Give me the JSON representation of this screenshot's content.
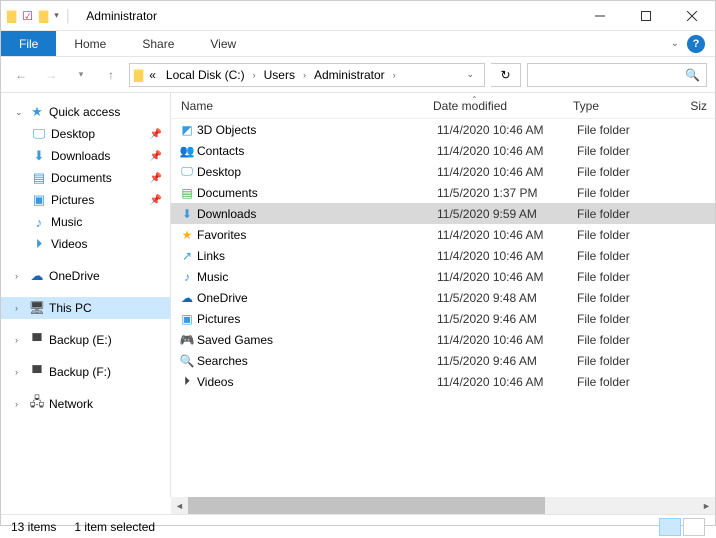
{
  "window": {
    "title": "Administrator"
  },
  "ribbon": {
    "file": "File",
    "tabs": [
      "Home",
      "Share",
      "View"
    ]
  },
  "breadcrumbs": {
    "prefix": "«",
    "items": [
      "Local Disk (C:)",
      "Users",
      "Administrator"
    ]
  },
  "search": {
    "placeholder": ""
  },
  "nav": {
    "quick": "Quick access",
    "quick_items": [
      {
        "label": "Desktop",
        "pinned": true
      },
      {
        "label": "Downloads",
        "pinned": true
      },
      {
        "label": "Documents",
        "pinned": true
      },
      {
        "label": "Pictures",
        "pinned": true
      },
      {
        "label": "Music",
        "pinned": false
      },
      {
        "label": "Videos",
        "pinned": false
      }
    ],
    "onedrive": "OneDrive",
    "thispc": "This PC",
    "backup_e": "Backup (E:)",
    "backup_f": "Backup (F:)",
    "network": "Network"
  },
  "columns": {
    "name": "Name",
    "date": "Date modified",
    "type": "Type",
    "size": "Siz"
  },
  "items": [
    {
      "name": "3D Objects",
      "date": "11/4/2020 10:46 AM",
      "type": "File folder",
      "icon": "cube",
      "selected": false
    },
    {
      "name": "Contacts",
      "date": "11/4/2020 10:46 AM",
      "type": "File folder",
      "icon": "contacts",
      "selected": false
    },
    {
      "name": "Desktop",
      "date": "11/4/2020 10:46 AM",
      "type": "File folder",
      "icon": "desktop",
      "selected": false
    },
    {
      "name": "Documents",
      "date": "11/5/2020 1:37 PM",
      "type": "File folder",
      "icon": "doc",
      "selected": false
    },
    {
      "name": "Downloads",
      "date": "11/5/2020 9:59 AM",
      "type": "File folder",
      "icon": "download",
      "selected": true
    },
    {
      "name": "Favorites",
      "date": "11/4/2020 10:46 AM",
      "type": "File folder",
      "icon": "star",
      "selected": false
    },
    {
      "name": "Links",
      "date": "11/4/2020 10:46 AM",
      "type": "File folder",
      "icon": "link",
      "selected": false
    },
    {
      "name": "Music",
      "date": "11/4/2020 10:46 AM",
      "type": "File folder",
      "icon": "music",
      "selected": false
    },
    {
      "name": "OneDrive",
      "date": "11/5/2020 9:48 AM",
      "type": "File folder",
      "icon": "cloud",
      "selected": false
    },
    {
      "name": "Pictures",
      "date": "11/5/2020 9:46 AM",
      "type": "File folder",
      "icon": "pic",
      "selected": false
    },
    {
      "name": "Saved Games",
      "date": "11/4/2020 10:46 AM",
      "type": "File folder",
      "icon": "game",
      "selected": false
    },
    {
      "name": "Searches",
      "date": "11/5/2020 9:46 AM",
      "type": "File folder",
      "icon": "search",
      "selected": false
    },
    {
      "name": "Videos",
      "date": "11/4/2020 10:46 AM",
      "type": "File folder",
      "icon": "video",
      "selected": false
    }
  ],
  "status": {
    "count": "13 items",
    "selected": "1 item selected"
  }
}
